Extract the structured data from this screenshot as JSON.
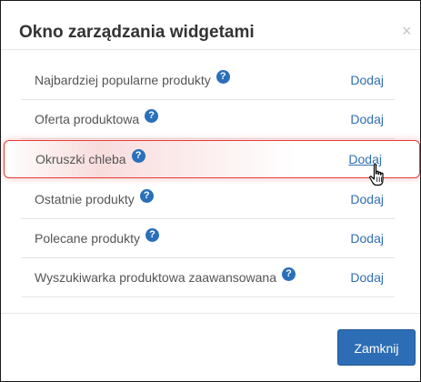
{
  "dialog": {
    "title": "Okno zarządzania widgetami",
    "close_symbol": "×",
    "help_symbol": "?",
    "items": [
      {
        "label": "Najbardziej popularne produkty",
        "action": "Dodaj"
      },
      {
        "label": "Oferta produktowa",
        "action": "Dodaj"
      },
      {
        "label": "Okruszki chleba",
        "action": "Dodaj",
        "highlighted": true
      },
      {
        "label": "Ostatnie produkty",
        "action": "Dodaj"
      },
      {
        "label": "Polecane produkty",
        "action": "Dodaj"
      },
      {
        "label": "Wyszukiwarka produktowa zaawansowana",
        "action": "Dodaj"
      }
    ],
    "close_button_label": "Zamknij"
  },
  "colors": {
    "accent": "#2d6db5",
    "link": "#2f6fb3",
    "highlight_border": "#e53b3b"
  },
  "icons": {
    "help": "help-icon",
    "close": "close-icon",
    "cursor": "hand-pointer-icon"
  }
}
